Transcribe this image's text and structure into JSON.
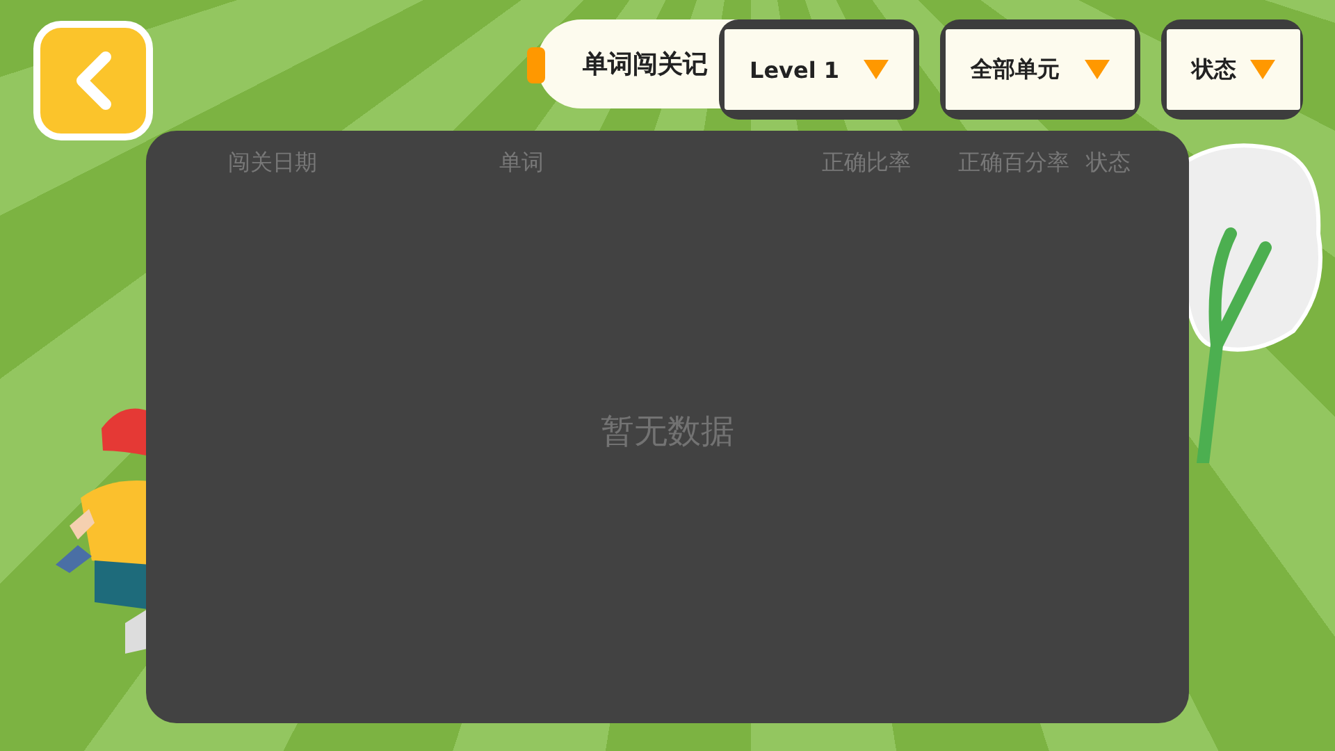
{
  "title": "单词闯关记",
  "filters": [
    {
      "label": "Level 1"
    },
    {
      "label": "全部单元"
    },
    {
      "label": "状态"
    }
  ],
  "table": {
    "columns": [
      "闯关日期",
      "单词",
      "正确比率",
      "正确百分率",
      "状态"
    ],
    "empty_text": "暂无数据"
  }
}
